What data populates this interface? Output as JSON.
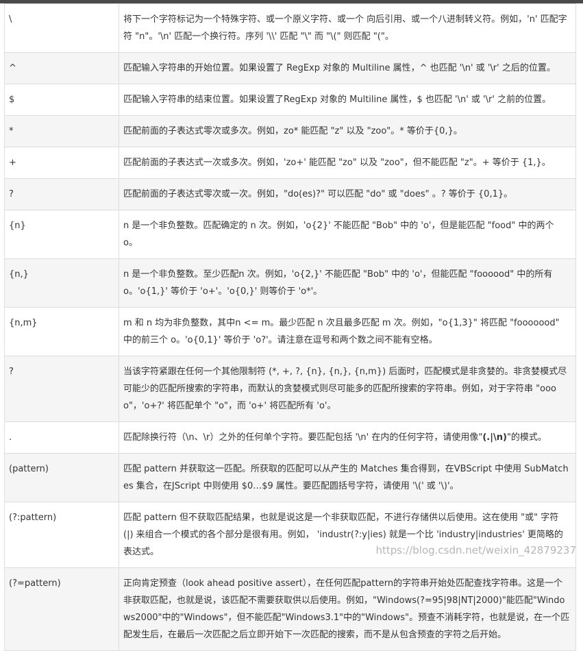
{
  "rows": [
    {
      "char": "\\",
      "desc": "将下一个字符标记为一个特殊字符、或一个原义字符、或一个 向后引用、或一个八进制转义符。例如，'n' 匹配字符 \"n\"。'\\n' 匹配一个换行符。序列 '\\\\' 匹配 \"\\\" 而 \"\\(\" 则匹配 \"(\"。"
    },
    {
      "char": "^",
      "desc": "匹配输入字符串的开始位置。如果设置了 RegExp 对象的 Multiline 属性，^ 也匹配 '\\n' 或 '\\r' 之后的位置。"
    },
    {
      "char": "$",
      "desc": "匹配输入字符串的结束位置。如果设置了RegExp 对象的 Multiline 属性，$ 也匹配 '\\n' 或 '\\r' 之前的位置。"
    },
    {
      "char": "*",
      "desc": "匹配前面的子表达式零次或多次。例如，zo* 能匹配 \"z\" 以及 \"zoo\"。* 等价于{0,}。"
    },
    {
      "char": "+",
      "desc": "匹配前面的子表达式一次或多次。例如，'zo+' 能匹配 \"zo\" 以及 \"zoo\"，但不能匹配 \"z\"。+ 等价于 {1,}。"
    },
    {
      "char": "?",
      "desc": "匹配前面的子表达式零次或一次。例如，\"do(es)?\" 可以匹配 \"do\" 或 \"does\" 。? 等价于 {0,1}。"
    },
    {
      "char": "{n}",
      "desc": "n 是一个非负整数。匹配确定的 n 次。例如，'o{2}' 不能匹配 \"Bob\" 中的 'o'，但是能匹配 \"food\" 中的两个 o。"
    },
    {
      "char": "{n,}",
      "desc": "n 是一个非负整数。至少匹配n 次。例如，'o{2,}' 不能匹配 \"Bob\" 中的 'o'，但能匹配 \"foooood\" 中的所有 o。'o{1,}' 等价于 'o+'。'o{0,}' 则等价于 'o*'。"
    },
    {
      "char": "{n,m}",
      "desc": "m 和 n 均为非负整数，其中n <= m。最少匹配 n 次且最多匹配 m 次。例如，\"o{1,3}\" 将匹配 \"fooooood\" 中的前三个 o。'o{0,1}' 等价于 'o?'。请注意在逗号和两个数之间不能有空格。"
    },
    {
      "char": "?",
      "desc": "当该字符紧跟在任何一个其他限制符 (*, +, ?, {n}, {n,}, {n,m}) 后面时，匹配模式是非贪婪的。非贪婪模式尽可能少的匹配所搜索的字符串，而默认的贪婪模式则尽可能多的匹配所搜索的字符串。例如，对于字符串 \"oooo\"，'o+?' 将匹配单个 \"o\"，而 'o+' 将匹配所有 'o'。"
    },
    {
      "char": ".",
      "desc": "匹配除换行符（\\n、\\r）之外的任何单个字符。要匹配包括 '\\n' 在内的任何字符，请使用像\"",
      "desc_bold": "(.|\\n)",
      "desc_tail": "\"的模式。"
    },
    {
      "char": "(pattern)",
      "desc": "匹配 pattern 并获取这一匹配。所获取的匹配可以从产生的 Matches 集合得到，在VBScript 中使用 SubMatches 集合，在JScript 中则使用 $0…$9 属性。要匹配圆括号字符，请使用 '\\(' 或 '\\)'。"
    },
    {
      "char": "(?:pattern)",
      "desc": "匹配 pattern 但不获取匹配结果，也就是说这是一个非获取匹配，不进行存储供以后使用。这在使用 \"或\" 字符 (|) 来组合一个模式的各个部分是很有用。例如， 'industr(?:y|ies) 就是一个比 'industry|industries' 更简略的表达式。"
    },
    {
      "char": "(?=pattern)",
      "desc": "正向肯定预查（look ahead positive assert），在任何匹配pattern的字符串开始处匹配查找字符串。这是一个非获取匹配，也就是说，该匹配不需要获取供以后使用。例如，\"Windows(?=95|98|NT|2000)\"能匹配\"Windows2000\"中的\"Windows\"，但不能匹配\"Windows3.1\"中的\"Windows\"。预查不消耗字符，也就是说，在一个匹配发生后，在最后一次匹配之后立即开始下一次匹配的搜索，而不是从包含预查的字符之后开始。"
    }
  ],
  "watermark": "https://blog.csdn.net/weixin_42879237",
  "colors": {
    "top_bar": "#4a4a4a",
    "row_alt": "#f5f5f5",
    "border": "#dddddd",
    "text": "#333333"
  }
}
